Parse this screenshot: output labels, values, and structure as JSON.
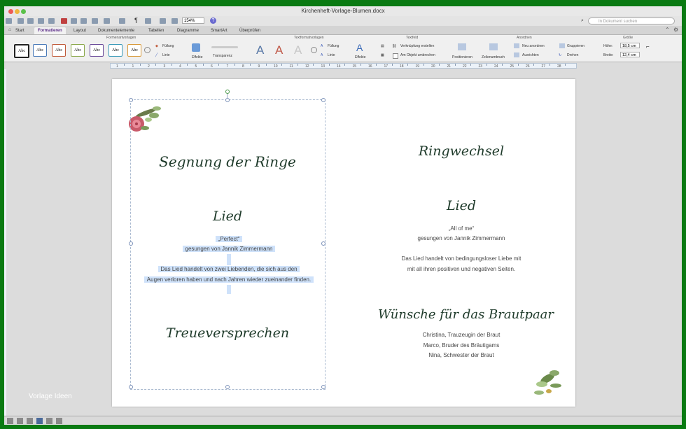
{
  "window": {
    "title": "Kirchenheft-Vorlage-Blumen.docx"
  },
  "toolbar": {
    "zoom": "154%",
    "search_placeholder": "In Dokument suchen"
  },
  "tabs": [
    {
      "label": "Start"
    },
    {
      "label": "Formatieren"
    },
    {
      "label": "Layout"
    },
    {
      "label": "Dokumentelemente"
    },
    {
      "label": "Tabellen"
    },
    {
      "label": "Diagramme"
    },
    {
      "label": "SmartArt"
    },
    {
      "label": "Überprüfen"
    }
  ],
  "ribbon": {
    "group_shape_styles": "Formenartvorlagen",
    "group_text_styles": "Textformatvorlagen",
    "group_textbox": "Textfeld",
    "group_arrange": "Anordnen",
    "group_size": "Größe",
    "abc_label": "Abc",
    "fill": "Füllung",
    "line": "Linie",
    "effects": "Effekte",
    "transparency": "Transparenz",
    "text_fill": "Füllung",
    "text_line": "Linie",
    "text_effects": "Effekte",
    "link_create": "Verknüpfung erstellen",
    "wrap_around": "Am Objekt umbrechen",
    "position": "Positionieren",
    "text_wrap": "Zeilenumbruch",
    "reorder": "Neu anordnen",
    "align": "Ausrichten",
    "group": "Gruppieren",
    "rotate": "Drehen",
    "height_label": "Höhe:",
    "height_value": "18,5 cm",
    "width_label": "Breite:",
    "width_value": "12,4 cm"
  },
  "ruler": {
    "numbers": [
      "1",
      "1",
      "2",
      "3",
      "4",
      "5",
      "6",
      "7",
      "8",
      "9",
      "10",
      "11",
      "12",
      "13",
      "14",
      "15",
      "16",
      "17",
      "18",
      "19",
      "20",
      "21",
      "22",
      "23",
      "24",
      "25",
      "26",
      "27",
      "28"
    ]
  },
  "document": {
    "left": {
      "heading1": "Segnung der Ringe",
      "heading2": "Lied",
      "song_title": "„Perfect“",
      "song_singer": "gesungen von Jannik Zimmermann",
      "desc_line1": "Das Lied handelt von zwei Liebenden, die sich aus den",
      "desc_line2": "Augen verloren haben und nach Jahren wieder zueinander finden.",
      "heading3": "Treueversprechen"
    },
    "right": {
      "heading1": "Ringwechsel",
      "heading2": "Lied",
      "song_title": "„All of me“",
      "song_singer": "gesungen von Jannik Zimmermann",
      "desc_line1": "Das Lied handelt von bedingungsloser Liebe mit",
      "desc_line2": "mit all ihren positiven und negativen Seiten.",
      "heading3": "Wünsche für das Brautpaar",
      "wish1": "Christina, Trauzeugin der Braut",
      "wish2": "Marco, Bruder des Bräutigams",
      "wish3": "Nina, Schwester der Braut"
    }
  },
  "watermark": "Vorlage Ideen",
  "colors": {
    "accent": "#5a2a88",
    "selection": "#cfe2fa",
    "script_text": "#1e3a2a"
  }
}
